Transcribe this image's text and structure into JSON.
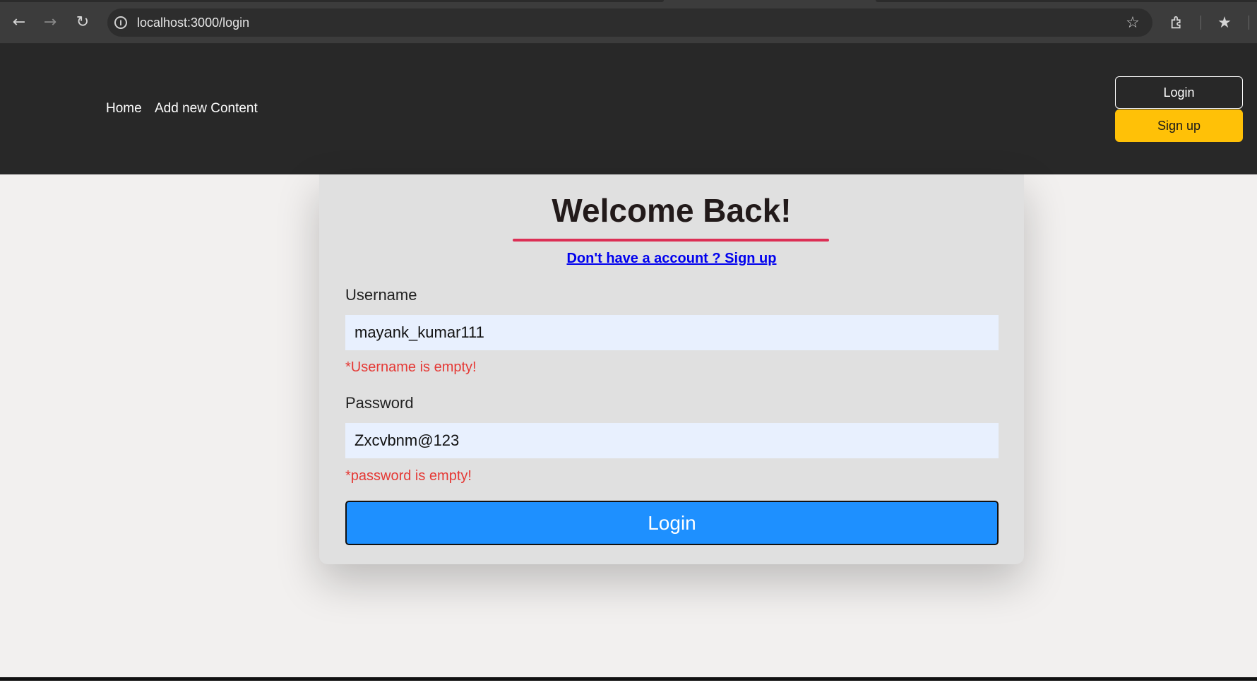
{
  "browser": {
    "url": "localhost:3000/login",
    "icons": [
      "back-arrow-icon",
      "forward-arrow-icon",
      "reload-icon",
      "info-icon",
      "star-icon",
      "extensions-icon",
      "bookmarks-icon"
    ]
  },
  "navbar": {
    "links": [
      "Home",
      "Add new Content"
    ],
    "login_label": "Login",
    "signup_label": "Sign up",
    "signup_color": "#ffc107",
    "background": "#282828"
  },
  "login_form": {
    "title": "Welcome Back!",
    "signup_prompt": "Don't have a account ? Sign up",
    "username_label": "Username",
    "username_value": "mayank_kumar111",
    "username_error": "*Username is empty!",
    "password_label": "Password",
    "password_value": "Zxcvbnm@123",
    "password_error": "*password is empty!",
    "submit_label": "Login",
    "accent_color": "#dc2f55",
    "button_color": "#1e90ff",
    "error_color": "#e53935"
  }
}
